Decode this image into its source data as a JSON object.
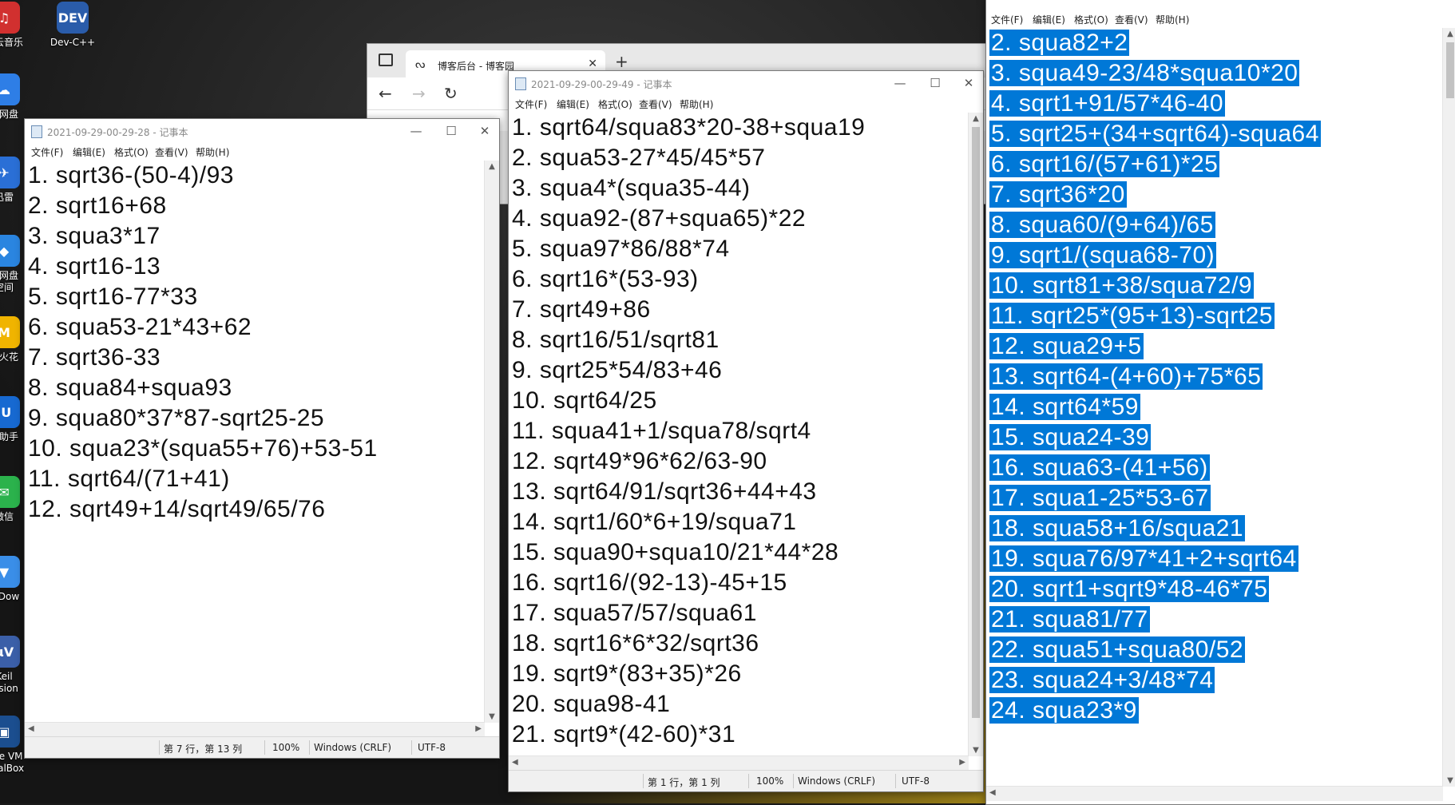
{
  "desktop": {
    "icons": [
      {
        "label": "易云音乐",
        "glyph": "♫",
        "color": "#d1302f"
      },
      {
        "label": "Dev-C++",
        "glyph": "DEV",
        "color": "#2a5caa"
      },
      {
        "label": "度网盘",
        "glyph": "☁",
        "color": "#2e7ee6"
      },
      {
        "label": "迅雷",
        "glyph": "✈",
        "color": "#2a6fd6"
      },
      {
        "label": "度网盘\n空间",
        "glyph": "◆",
        "color": "#2a85e0"
      },
      {
        "label": "小火花",
        "glyph": "M",
        "color": "#f0b400"
      },
      {
        "label": "思助手",
        "glyph": "iU",
        "color": "#1769d1"
      },
      {
        "label": "微信",
        "glyph": "✉",
        "color": "#2bb24c"
      },
      {
        "label": "即Dow",
        "glyph": "▼",
        "color": "#3a8ee8"
      },
      {
        "label": "Keil\nVision",
        "glyph": "μV",
        "color": "#3b5fa8"
      },
      {
        "label": "acle VM\nrtualBox",
        "glyph": "▣",
        "color": "#1b4e8f"
      }
    ]
  },
  "browser": {
    "tab_title": "博客后台 - 博客园",
    "new_tab": "+",
    "back": "←",
    "forward": "→",
    "refresh": "↻"
  },
  "notepad_left": {
    "title": "2021-09-29-00-29-28 - 记事本",
    "menu": [
      "文件(F)",
      "编辑(E)",
      "格式(O)",
      "查看(V)",
      "帮助(H)"
    ],
    "lines": [
      "1. sqrt36-(50-4)/93",
      "2. sqrt16+68",
      "3. squa3*17",
      "4. sqrt16-13",
      "5. sqrt16-77*33",
      "6. squa53-21*43+62",
      "7. sqrt36-33",
      "8. squa84+squa93",
      "9. squa80*37*87-sqrt25-25",
      "10. squa23*(squa55+76)+53-51",
      "11. sqrt64/(71+41)",
      "12. sqrt49+14/sqrt49/65/76"
    ],
    "status": {
      "position": "第 7 行，第 13 列",
      "zoom": "100%",
      "eol": "Windows (CRLF)",
      "encoding": "UTF-8"
    }
  },
  "notepad_mid": {
    "title": "2021-09-29-00-29-49 - 记事本",
    "menu": [
      "文件(F)",
      "编辑(E)",
      "格式(O)",
      "查看(V)",
      "帮助(H)"
    ],
    "lines": [
      "1. sqrt64/squa83*20-38+squa19",
      "2. squa53-27*45/45*57",
      "3. squa4*(squa35-44)",
      "4. squa92-(87+squa65)*22",
      "5. squa97*86/88*74",
      "6. sqrt16*(53-93)",
      "7. sqrt49+86",
      "8. sqrt16/51/sqrt81",
      "9. sqrt25*54/83+46",
      "10. sqrt64/25",
      "11. squa41+1/squa78/sqrt4",
      "12. sqrt49*96*62/63-90",
      "13. sqrt64/91/sqrt36+44+43",
      "14. sqrt1/60*6+19/squa71",
      "15. squa90+squa10/21*44*28",
      "16. sqrt16/(92-13)-45+15",
      "17. squa57/57/squa61",
      "18. sqrt16*6*32/sqrt36",
      "19. sqrt9*(83+35)*26",
      "20. squa98-41",
      "21. sqrt9*(42-60)*31"
    ],
    "status": {
      "position": "第 1 行，第 1 列",
      "zoom": "100%",
      "eol": "Windows (CRLF)",
      "encoding": "UTF-8"
    }
  },
  "notepad_right": {
    "menu": [
      "文件(F)",
      "编辑(E)",
      "格式(O)",
      "查看(V)",
      "帮助(H)"
    ],
    "lines": [
      "2. squa82+2",
      "3. squa49-23/48*squa10*20",
      "4. sqrt1+91/57*46-40",
      "5. sqrt25+(34+sqrt64)-squa64",
      "6. sqrt16/(57+61)*25",
      "7. sqrt36*20",
      "8. squa60/(9+64)/65",
      "9. sqrt1/(squa68-70)",
      "10. sqrt81+38/squa72/9",
      "11. sqrt25*(95+13)-sqrt25",
      "12. squa29+5",
      "13. sqrt64-(4+60)+75*65",
      "14. sqrt64*59",
      "15. squa24-39",
      "16. squa63-(41+56)",
      "17. squa1-25*53-67",
      "18. squa58+16/squa21",
      "19. squa76/97*41+2+sqrt64",
      "20. sqrt1+sqrt9*48-46*75",
      "21. squa81/77",
      "22. squa51+squa80/52",
      "23. squa24+3/48*74",
      "24. squa23*9"
    ],
    "selection_color": "#0078d7"
  }
}
